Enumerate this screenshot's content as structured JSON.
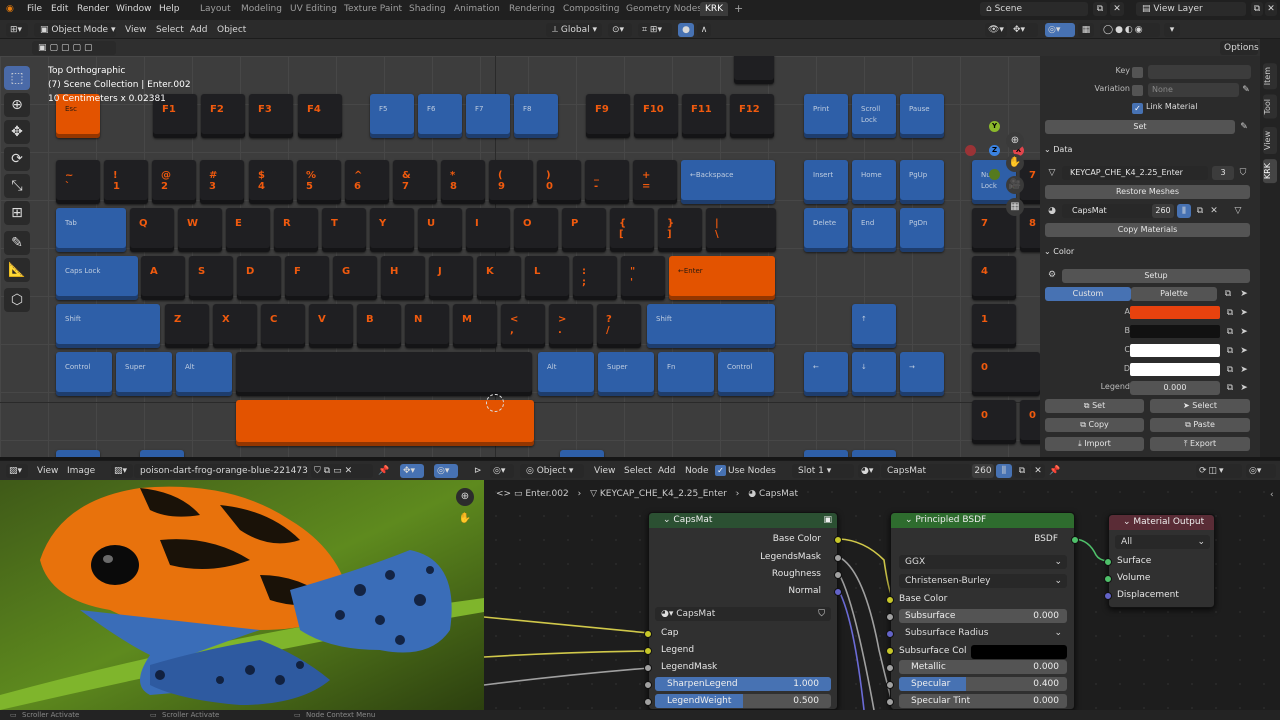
{
  "topbar": {
    "menus": [
      "File",
      "Edit",
      "Render",
      "Window",
      "Help"
    ],
    "workspaces": [
      "Layout",
      "Modeling",
      "UV Editing",
      "Texture Paint",
      "Shading",
      "Animation",
      "Rendering",
      "Compositing",
      "Geometry Nodes",
      "KRK"
    ],
    "active_workspace": "KRK",
    "add_tab": "+",
    "scene": "Scene",
    "view_layer": "View Layer"
  },
  "viewport_header": {
    "mode": "Object Mode",
    "menus": [
      "View",
      "Select",
      "Add",
      "Object"
    ],
    "orientation": "Global",
    "options": "Options"
  },
  "viewport": {
    "view_name": "Top Orthographic",
    "collection": "(7) Scene Collection | Enter.002",
    "scale": "10 Centimeters x 0.02381",
    "gizmo_labels": {
      "y": "Y",
      "z": "Z",
      "x": "X"
    }
  },
  "keyboard": {
    "frow": [
      "Esc",
      "F1",
      "F2",
      "F3",
      "F4",
      "F5",
      "F6",
      "F7",
      "F8",
      "F9",
      "F10",
      "F11",
      "F12",
      "Print",
      "Scroll\nLock",
      "Pause"
    ],
    "numrow": [
      "~\n`",
      "!\n1",
      "@\n2",
      "#\n3",
      "$\n4",
      "%\n5",
      "^\n6",
      "&\n7",
      "*\n8",
      "(\n9",
      ")\n0",
      "_\n-",
      "+\n=",
      "←Backspace",
      "Insert",
      "Home",
      "PgUp",
      "Num\nLock",
      "7"
    ],
    "qrow": [
      "Tab",
      "Q",
      "W",
      "E",
      "R",
      "T",
      "Y",
      "U",
      "I",
      "O",
      "P",
      "{\n[",
      "}\n]",
      "|\n\\",
      "Delete",
      "End",
      "PgDn",
      "7",
      "8"
    ],
    "arow": [
      "Caps Lock",
      "A",
      "S",
      "D",
      "F",
      "G",
      "H",
      "J",
      "K",
      "L",
      ":\n;",
      "\"\n'",
      "←Enter",
      "4"
    ],
    "zrow": [
      "Shift",
      "Z",
      "X",
      "C",
      "V",
      "B",
      "N",
      "M",
      "<\n,",
      ">\n.",
      "?\n/",
      "Shift",
      "↑",
      "1"
    ],
    "brow": [
      "Control",
      "Super",
      "Alt",
      "",
      "Alt",
      "Super",
      "Fn",
      "Control",
      "←",
      "↓",
      "→",
      "0"
    ],
    "extra": [
      "0",
      "0"
    ]
  },
  "properties": {
    "key_label": "Key",
    "variation_label": "Variation",
    "variation_value": "None",
    "link_material": "Link Material",
    "set_btn": "Set",
    "data_section": "Data",
    "mesh_name": "KEYCAP_CHE_K4_2.25_Enter",
    "mesh_users": "3",
    "restore_meshes": "Restore Meshes",
    "material_name": "CapsMat",
    "material_users": "260",
    "copy_materials": "Copy Materials",
    "color_section": "Color",
    "setup": "Setup",
    "custom_tab": "Custom",
    "palette_tab": "Palette",
    "color_labels": [
      "A",
      "B",
      "C",
      "D"
    ],
    "color_values": [
      "#e8420e",
      "#111111",
      "#ffffff",
      "#ffffff"
    ],
    "legend_label": "Legend",
    "legend_value": "0.000",
    "buttons": [
      "Set",
      "Select",
      "Copy",
      "Paste",
      "Import",
      "Export"
    ],
    "side_tabs": [
      "Item",
      "Tool",
      "View",
      "KRK"
    ]
  },
  "image_editor": {
    "menus": [
      "View",
      "Image"
    ],
    "filename": "poison-dart-frog-orange-blue-221473961.jpg"
  },
  "node_editor": {
    "object_mode": "Object",
    "menus": [
      "View",
      "Select",
      "Add",
      "Node"
    ],
    "use_nodes": "Use Nodes",
    "slot": "Slot 1",
    "material": "CapsMat",
    "material_users": "260",
    "breadcrumb": [
      "Enter.002",
      "KEYCAP_CHE_K4_2.25_Enter",
      "CapsMat"
    ],
    "group_node": {
      "title": "CapsMat",
      "outputs": [
        "Base Color",
        "LegendsMask",
        "Roughness",
        "Normal"
      ],
      "datablock": "CapsMat",
      "inputs": [
        "Cap",
        "Legend",
        "LegendMask"
      ],
      "sliders": [
        {
          "label": "SharpenLegend",
          "value": "1.000",
          "fill": 1.0
        },
        {
          "label": "LegendWeight",
          "value": "0.500",
          "fill": 0.5
        }
      ]
    },
    "bsdf_node": {
      "title": "Principled BSDF",
      "output": "BSDF",
      "distribution": "GGX",
      "subsurface_method": "Christensen-Burley",
      "base_color": "Base Color",
      "subsurface": {
        "label": "Subsurface",
        "value": "0.000"
      },
      "subsurface_radius": "Subsurface Radius",
      "subsurface_col": "Subsurface Col",
      "metallic": {
        "label": "Metallic",
        "value": "0.000",
        "fill": 0.0
      },
      "specular": {
        "label": "Specular",
        "value": "0.400",
        "fill": 0.4
      },
      "specular_tint": {
        "label": "Specular Tint",
        "value": "0.000"
      }
    },
    "output_node": {
      "title": "Material Output",
      "target": "All",
      "inputs": [
        "Surface",
        "Volume",
        "Displacement"
      ]
    }
  },
  "statusbar": [
    "Scroller Activate",
    "Scroller Activate",
    "Node Context Menu"
  ],
  "colors": {
    "accent": "#4772b3",
    "keycap_orange": "#e35300",
    "keycap_blue": "#2e5fa8",
    "legend_orange": "#f05a0e"
  }
}
